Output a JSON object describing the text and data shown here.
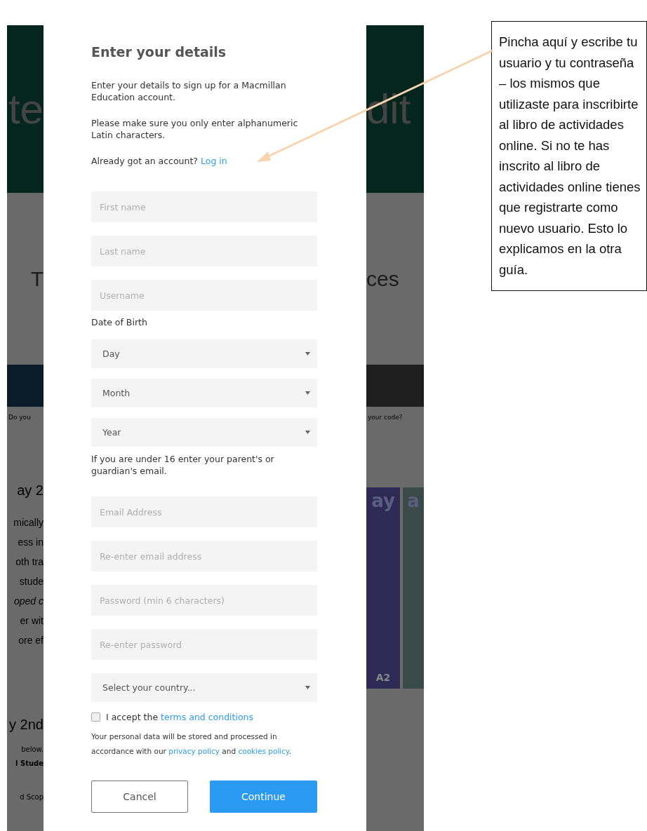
{
  "background": {
    "header_left": "te",
    "header_right": "dit",
    "subtitle_left": "T",
    "subtitle_right": "ces",
    "note_left": "Do you",
    "note_right": "your code?",
    "heading_left": "ay 2",
    "body_left": [
      {
        "text": "mically",
        "italic": false
      },
      {
        "text": "ess in",
        "italic": false
      },
      {
        "text": "oth tra",
        "italic": false
      },
      {
        "text": "stude",
        "italic": false
      },
      {
        "text": "oped c",
        "italic": true
      },
      {
        "text": "er wit",
        "italic": false
      },
      {
        "text": "ore ef",
        "italic": false
      }
    ],
    "heading2_left": "y 2nd",
    "body2_left": [
      {
        "text": "below.",
        "bold": false
      },
      {
        "text": "l Stude",
        "bold": true
      }
    ],
    "last_left": "d Scop",
    "books": [
      {
        "title": "ay",
        "badge": "A2"
      },
      {
        "title": "a"
      }
    ]
  },
  "modal": {
    "title": "Enter your details",
    "intro": "Enter your details to sign up for a Macmillan Education account.",
    "note": "Please make sure you only enter alphanumeric Latin characters.",
    "login": {
      "text": "Already got an account?",
      "link": "Log in"
    },
    "fields": [
      {
        "kind": "text",
        "placeholder": "First name"
      },
      {
        "kind": "text",
        "placeholder": "Last name"
      },
      {
        "kind": "text",
        "placeholder": "Username"
      },
      {
        "kind": "label",
        "text": "Date of Birth"
      },
      {
        "kind": "select",
        "value": "Day"
      },
      {
        "kind": "select",
        "value": "Month"
      },
      {
        "kind": "select",
        "value": "Year"
      },
      {
        "kind": "help",
        "text": "If you are under 16 enter your parent's or guardian's email."
      },
      {
        "kind": "text",
        "placeholder": "Email Address"
      },
      {
        "kind": "text",
        "placeholder": "Re-enter email address"
      },
      {
        "kind": "text",
        "placeholder": "Password (min 6 characters)"
      },
      {
        "kind": "text",
        "placeholder": "Re-enter password"
      },
      {
        "kind": "select",
        "value": "Select your country..."
      }
    ],
    "terms": {
      "checked": false,
      "text": "I accept the",
      "link": "terms and conditions"
    },
    "privacy": {
      "before": "Your personal data will be stored and processed in accordance with our",
      "link1": "privacy policy",
      "middle": "and",
      "link2": "cookies policy",
      "after": "."
    },
    "buttons": [
      {
        "kind": "secondary",
        "label": "Cancel"
      },
      {
        "kind": "primary",
        "label": "Continue"
      }
    ]
  },
  "annotation": {
    "text": "Pincha aquí y escribe tu usuario y tu contraseña – los mismos que utilizaste para inscribirte al libro de actividades online. Si no te has inscrito al libro de actividades online tienes que registrarte como nuevo usuario. Esto lo explicamos en la otra guía."
  }
}
